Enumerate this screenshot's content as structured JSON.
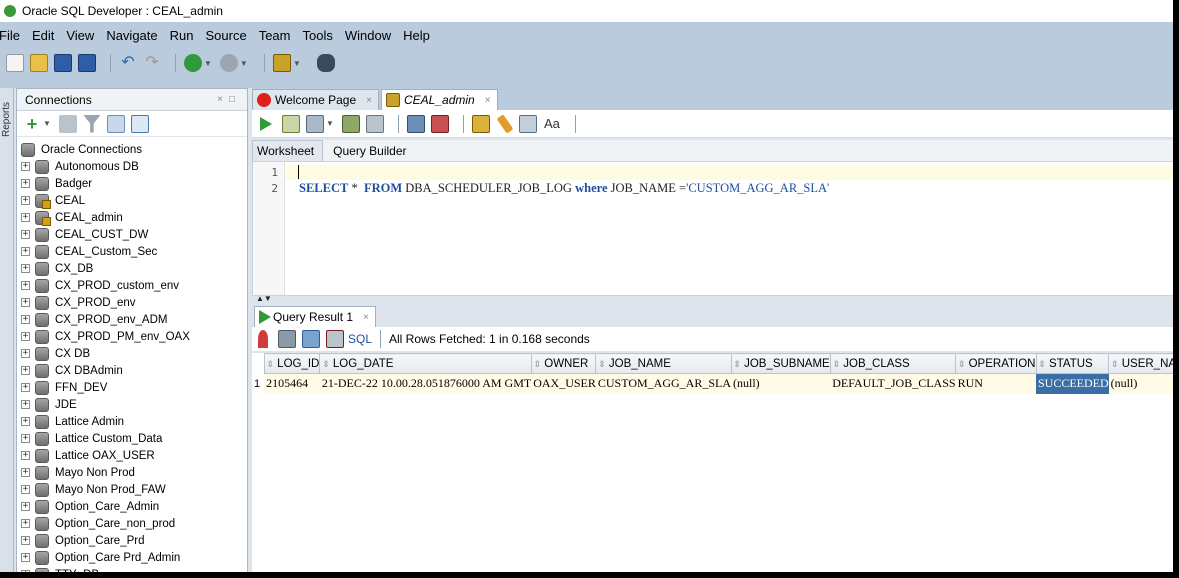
{
  "window": {
    "title": "Oracle SQL Developer : CEAL_admin"
  },
  "menu": [
    "File",
    "Edit",
    "View",
    "Navigate",
    "Run",
    "Source",
    "Team",
    "Tools",
    "Window",
    "Help"
  ],
  "left_rail": {
    "label": "Reports"
  },
  "connections": {
    "title": "Connections",
    "root_label": "Oracle Connections",
    "items": [
      {
        "label": "Autonomous DB",
        "icon": "database-icon"
      },
      {
        "label": "Badger",
        "icon": "database-icon"
      },
      {
        "label": "CEAL",
        "icon": "database-sql-icon"
      },
      {
        "label": "CEAL_admin",
        "icon": "database-sql-icon"
      },
      {
        "label": "CEAL_CUST_DW",
        "icon": "database-icon"
      },
      {
        "label": "CEAL_Custom_Sec",
        "icon": "database-icon"
      },
      {
        "label": "CX_DB",
        "icon": "database-icon"
      },
      {
        "label": "CX_PROD_custom_env",
        "icon": "database-icon"
      },
      {
        "label": "CX_PROD_env",
        "icon": "database-icon"
      },
      {
        "label": "CX_PROD_env_ADM",
        "icon": "database-icon"
      },
      {
        "label": "CX_PROD_PM_env_OAX",
        "icon": "database-icon"
      },
      {
        "label": "CX DB",
        "icon": "database-icon"
      },
      {
        "label": "CX DBAdmin",
        "icon": "database-icon"
      },
      {
        "label": "FFN_DEV",
        "icon": "database-icon"
      },
      {
        "label": "JDE",
        "icon": "database-icon"
      },
      {
        "label": "Lattice Admin",
        "icon": "database-icon"
      },
      {
        "label": "Lattice Custom_Data",
        "icon": "database-icon"
      },
      {
        "label": "Lattice OAX_USER",
        "icon": "database-icon"
      },
      {
        "label": "Mayo Non Prod",
        "icon": "database-icon"
      },
      {
        "label": "Mayo Non Prod_FAW",
        "icon": "database-icon"
      },
      {
        "label": "Option_Care_Admin",
        "icon": "database-icon"
      },
      {
        "label": "Option_Care_non_prod",
        "icon": "database-icon"
      },
      {
        "label": "Option_Care_Prd",
        "icon": "database-icon"
      },
      {
        "label": "Option_Care Prd_Admin",
        "icon": "database-icon"
      },
      {
        "label": "TTY_DB",
        "icon": "database-icon"
      }
    ]
  },
  "tabs": [
    {
      "label": "Welcome Page",
      "icon": "oracle-icon",
      "active": false
    },
    {
      "label": "CEAL_admin",
      "icon": "sql-worksheet-icon",
      "active": true
    }
  ],
  "subtabs": [
    "Worksheet",
    "Query Builder"
  ],
  "editor": {
    "line_numbers": [
      "1",
      "2"
    ],
    "sql": {
      "select": "SELECT",
      "star": " *  ",
      "from": "FROM",
      "table": " DBA_SCHEDULER_JOB_LOG ",
      "where": "where",
      "cond": " JOB_NAME =",
      "literal": "'CUSTOM_AGG_AR_SLA'"
    }
  },
  "results": {
    "tab_label": "Query Result 1",
    "sql_link": "SQL",
    "status": "All Rows Fetched: 1 in 0.168 seconds",
    "columns": [
      "LOG_ID",
      "LOG_DATE",
      "OWNER",
      "JOB_NAME",
      "JOB_SUBNAME",
      "JOB_CLASS",
      "OPERATION",
      "STATUS",
      "USER_NAME"
    ],
    "rows": [
      {
        "num": "1",
        "cells": [
          "2105464",
          "21-DEC-22 10.00.28.051876000 AM GMT",
          "OAX_USER",
          "CUSTOM_AGG_AR_SLA",
          "(null)",
          "DEFAULT_JOB_CLASS",
          "RUN",
          "SUCCEEDED",
          "(null)"
        ]
      }
    ]
  },
  "colors": {
    "menubar": "#b9cbdd",
    "keyword": "#1d4f9f",
    "selected_cell": "#3b6ea5",
    "current_line": "#fdfbe0"
  }
}
